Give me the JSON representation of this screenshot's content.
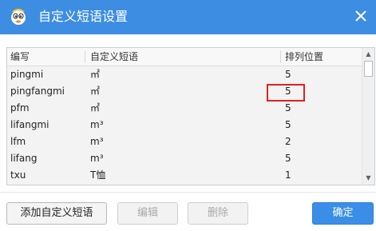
{
  "window": {
    "title": "自定义短语设置",
    "close_symbol": "×"
  },
  "list": {
    "columns": [
      "编写",
      "自定义短语",
      "排列位置"
    ],
    "rows": [
      {
        "code": "pingmi",
        "phrase": "㎡",
        "position": "5"
      },
      {
        "code": "pingfangmi",
        "phrase": "㎡",
        "position": "5"
      },
      {
        "code": "pfm",
        "phrase": "㎡",
        "position": "5"
      },
      {
        "code": "lifangmi",
        "phrase": "m³",
        "position": "5"
      },
      {
        "code": "lfm",
        "phrase": "m³",
        "position": "2"
      },
      {
        "code": "lifang",
        "phrase": "m³",
        "position": "5"
      },
      {
        "code": "txu",
        "phrase": "T恤",
        "position": "1"
      }
    ],
    "highlighted_row": 1,
    "scroll_up": "▲",
    "scroll_down": "▼"
  },
  "buttons": {
    "add": "添加自定义短语",
    "edit": "编辑",
    "delete": "删除",
    "ok": "确定"
  },
  "colors": {
    "titlebar": "#3d8ee3",
    "primary_button": "#3b8ee8",
    "highlight_border": "#e02020"
  },
  "icons": {
    "app": "sogou-mascot-icon",
    "close": "close-icon"
  }
}
